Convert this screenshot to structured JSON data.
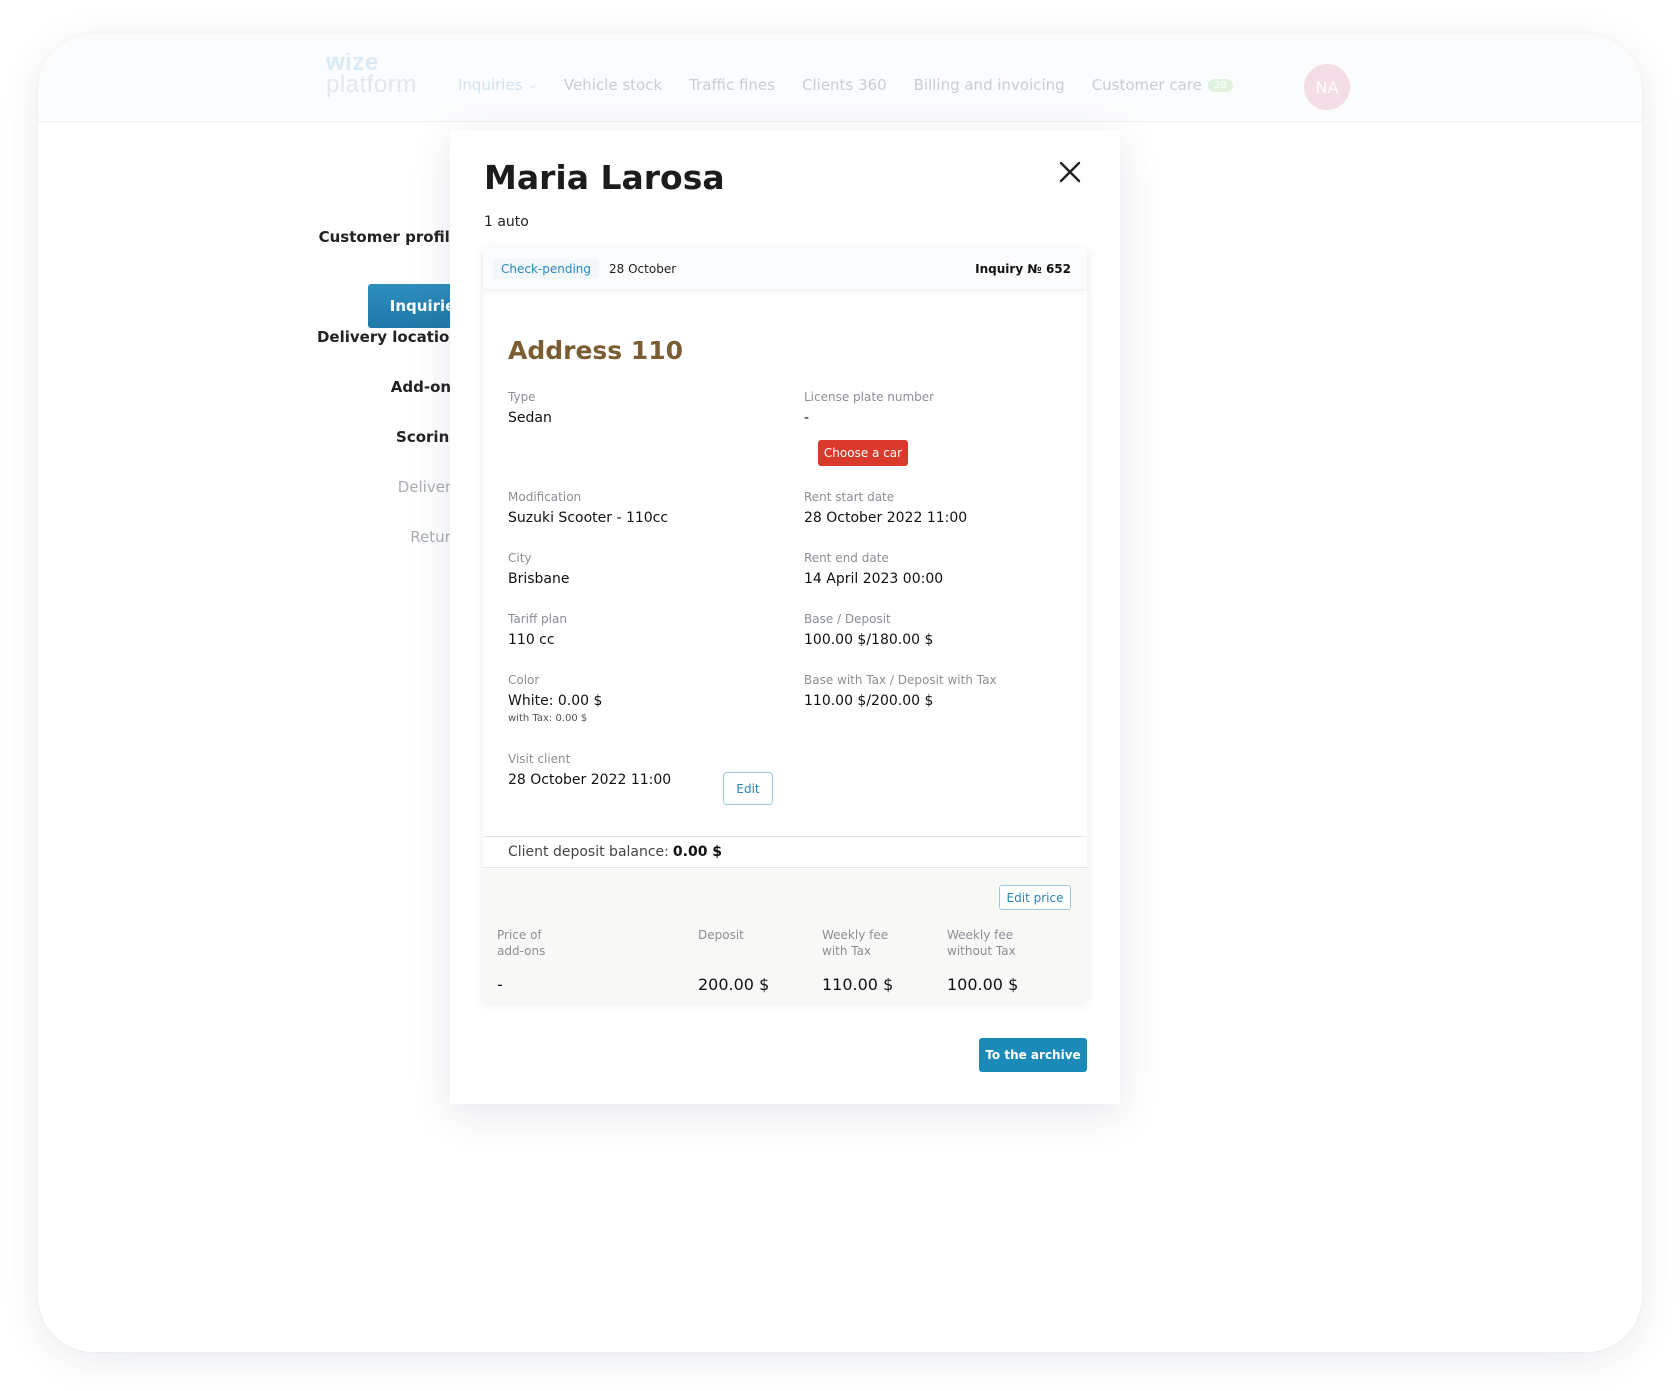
{
  "header": {
    "logo_line1": "wize",
    "logo_line2": "platform",
    "nav": [
      {
        "label": "Inquiries"
      },
      {
        "label": "Vehicle stock"
      },
      {
        "label": "Traffic fines"
      },
      {
        "label": "Clients 360"
      },
      {
        "label": "Billing and invoicing"
      },
      {
        "label": "Customer care",
        "badge": "28"
      }
    ],
    "avatar_initials": "NA"
  },
  "sidebar": {
    "items": [
      {
        "label": "Customer profile"
      },
      {
        "label": "Inquiries"
      },
      {
        "label": "Delivery location"
      },
      {
        "label": "Add-ons"
      },
      {
        "label": "Scoring"
      },
      {
        "label": "Delivery"
      },
      {
        "label": "Return"
      }
    ]
  },
  "modal": {
    "title": "Maria Larosa",
    "subtitle": "1 auto",
    "close_icon": "close-icon",
    "card": {
      "status": "Check-pending",
      "date": "28 October",
      "inquiry_number": "Inquiry № 652",
      "section_title": "Address 110",
      "fields": {
        "type_label": "Type",
        "type_value": "Sedan",
        "plate_label": "License plate number",
        "plate_value": "-",
        "choose_car": "Choose a car",
        "modification_label": "Modification",
        "modification_value": "Suzuki Scooter - 110cc",
        "start_label": "Rent start date",
        "start_value": "28 October 2022 11:00",
        "city_label": "City",
        "city_value": "Brisbane",
        "end_label": "Rent end date",
        "end_value": "14 April 2023 00:00",
        "tariff_label": "Tariff plan",
        "tariff_value": "110 cc",
        "base_label": "Base / Deposit",
        "base_value": "100.00 $/180.00 $",
        "color_label": "Color",
        "color_value": "White: 0.00 $",
        "color_sub": "with Tax: 0.00 $",
        "base_tax_label": "Base with Tax / Deposit with Tax",
        "base_tax_value": "110.00 $/200.00 $",
        "visit_label": "Visit client",
        "visit_value": "28 October 2022 11:00",
        "edit": "Edit"
      },
      "balance_label": "Client deposit balance:",
      "balance_value": "0.00 $",
      "price": {
        "edit_price": "Edit price",
        "addons_label": "Price of add-ons",
        "addons_value": "-",
        "deposit_label": "Deposit",
        "deposit_value": "200.00 $",
        "weekly_tax_label": "Weekly fee with Tax",
        "weekly_tax_value": "110.00 $",
        "weekly_notax_label": "Weekly fee without Tax",
        "weekly_notax_value": "100.00 $"
      }
    },
    "archive_button": "To the archive"
  },
  "colors": {
    "accent": "#1b8ab8",
    "danger": "#d93a2b",
    "section_title": "#7a5d32"
  }
}
